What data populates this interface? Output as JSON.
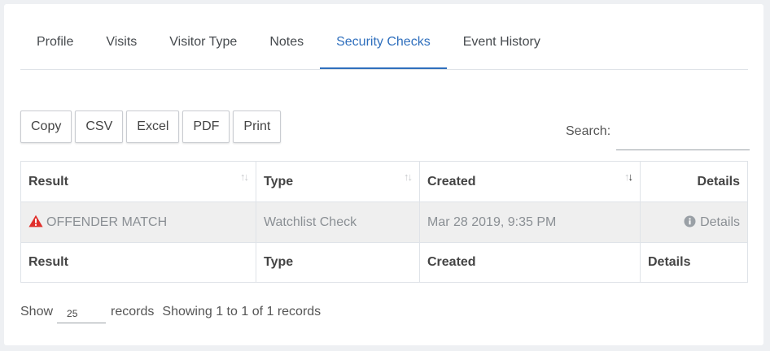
{
  "tabs": [
    {
      "label": "Profile",
      "active": false
    },
    {
      "label": "Visits",
      "active": false
    },
    {
      "label": "Visitor Type",
      "active": false
    },
    {
      "label": "Notes",
      "active": false
    },
    {
      "label": "Security Checks",
      "active": true
    },
    {
      "label": "Event History",
      "active": false
    }
  ],
  "buttons": {
    "copy": "Copy",
    "csv": "CSV",
    "excel": "Excel",
    "pdf": "PDF",
    "print": "Print"
  },
  "search": {
    "label": "Search:",
    "value": ""
  },
  "table": {
    "headers": {
      "result": "Result",
      "type": "Type",
      "created": "Created",
      "details": "Details"
    },
    "rows": [
      {
        "result": "OFFENDER MATCH",
        "type": "Watchlist Check",
        "created": "Mar 28 2019, 9:35 PM",
        "details": "Details"
      }
    ],
    "footers": {
      "result": "Result",
      "type": "Type",
      "created": "Created",
      "details": "Details"
    }
  },
  "footer": {
    "show_label": "Show",
    "page_length": "25",
    "records_label": "records",
    "info": "Showing 1 to 1 of 1 records"
  },
  "colors": {
    "accent": "#2f6fbd",
    "warning": "#e0302c",
    "info_icon": "#9aa0a6"
  }
}
